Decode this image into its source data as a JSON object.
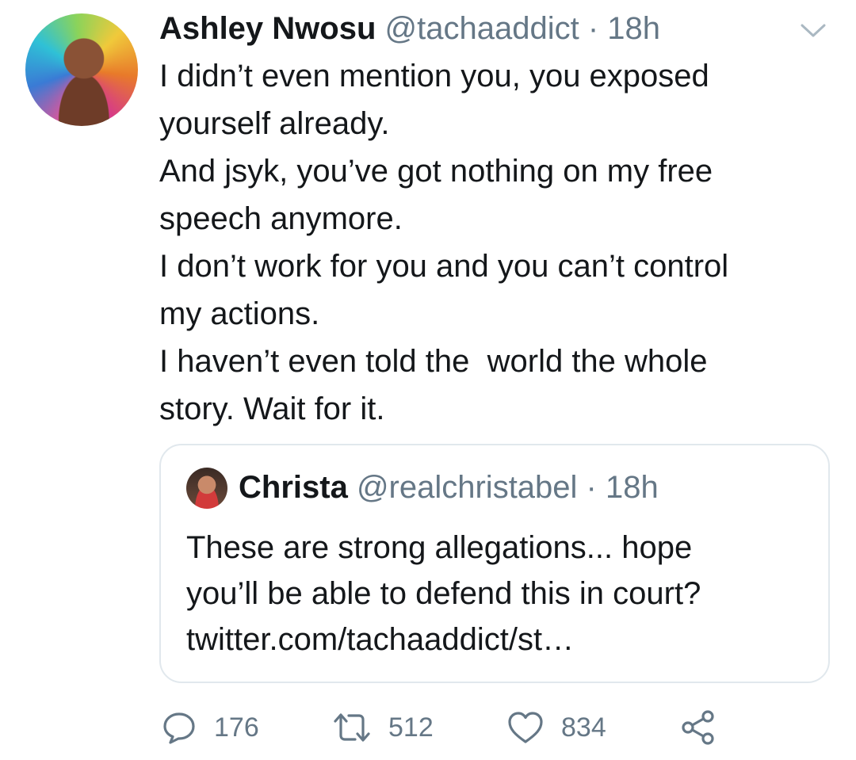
{
  "tweet": {
    "author_name": "Ashley Nwosu",
    "author_handle": "@tachaaddict",
    "separator": "·",
    "time": "18h",
    "lines": [
      "I didn’t even mention you, you exposed",
      "yourself already.",
      "And jsyk, you’ve got nothing on my free",
      "speech anymore.",
      "I don’t work for you and you can’t control",
      "my actions.",
      "I haven’t even told the  world the whole",
      "story. Wait for it."
    ]
  },
  "quoted": {
    "author_name": "Christa",
    "author_handle": "@realchristabel",
    "separator": "·",
    "time": "18h",
    "lines": [
      "These are strong allegations... hope",
      "you’ll be able to defend this in court?",
      "twitter.com/tachaaddict/st…"
    ]
  },
  "actions": {
    "replies": "176",
    "retweets": "512",
    "likes": "834"
  },
  "icons": {
    "menu": "chevron-down-icon",
    "reply": "reply-icon",
    "retweet": "retweet-icon",
    "like": "heart-icon",
    "share": "share-icon"
  },
  "colors": {
    "text": "#14171a",
    "secondary": "#657786",
    "border": "#e1e8ed"
  }
}
